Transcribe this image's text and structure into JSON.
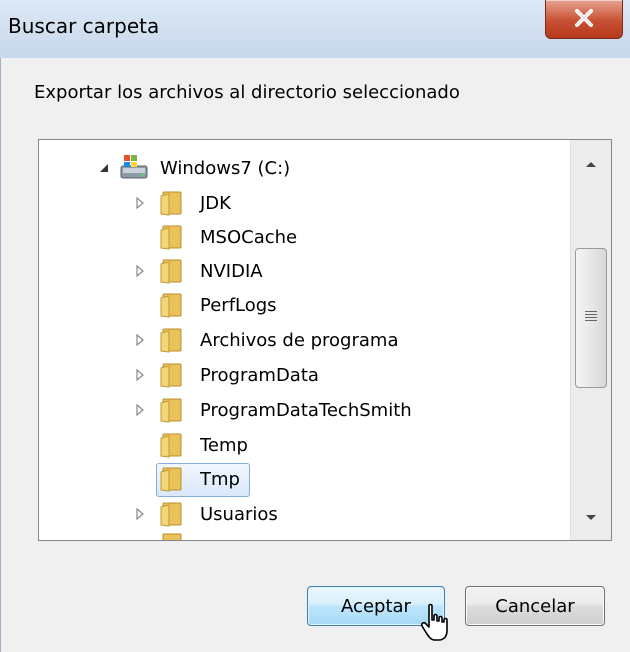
{
  "window": {
    "title": "Buscar carpeta",
    "close_icon": "close-icon"
  },
  "dialog": {
    "instruction": "Exportar los archivos al directorio seleccionado"
  },
  "tree": {
    "root": {
      "label": "Windows7 (C:)",
      "icon": "drive-icon",
      "expanded": true
    },
    "items": [
      {
        "label": "JDK",
        "has_children": true,
        "selected": false
      },
      {
        "label": "MSOCache",
        "has_children": false,
        "selected": false
      },
      {
        "label": "NVIDIA",
        "has_children": true,
        "selected": false
      },
      {
        "label": "PerfLogs",
        "has_children": false,
        "selected": false
      },
      {
        "label": "Archivos de programa",
        "has_children": true,
        "selected": false
      },
      {
        "label": "ProgramData",
        "has_children": true,
        "selected": false
      },
      {
        "label": "ProgramDataTechSmith",
        "has_children": true,
        "selected": false
      },
      {
        "label": "Temp",
        "has_children": false,
        "selected": false
      },
      {
        "label": "Tmp",
        "has_children": false,
        "selected": true
      },
      {
        "label": "Usuarios",
        "has_children": true,
        "selected": false
      }
    ]
  },
  "buttons": {
    "ok_label": "Aceptar",
    "cancel_label": "Cancelar"
  }
}
